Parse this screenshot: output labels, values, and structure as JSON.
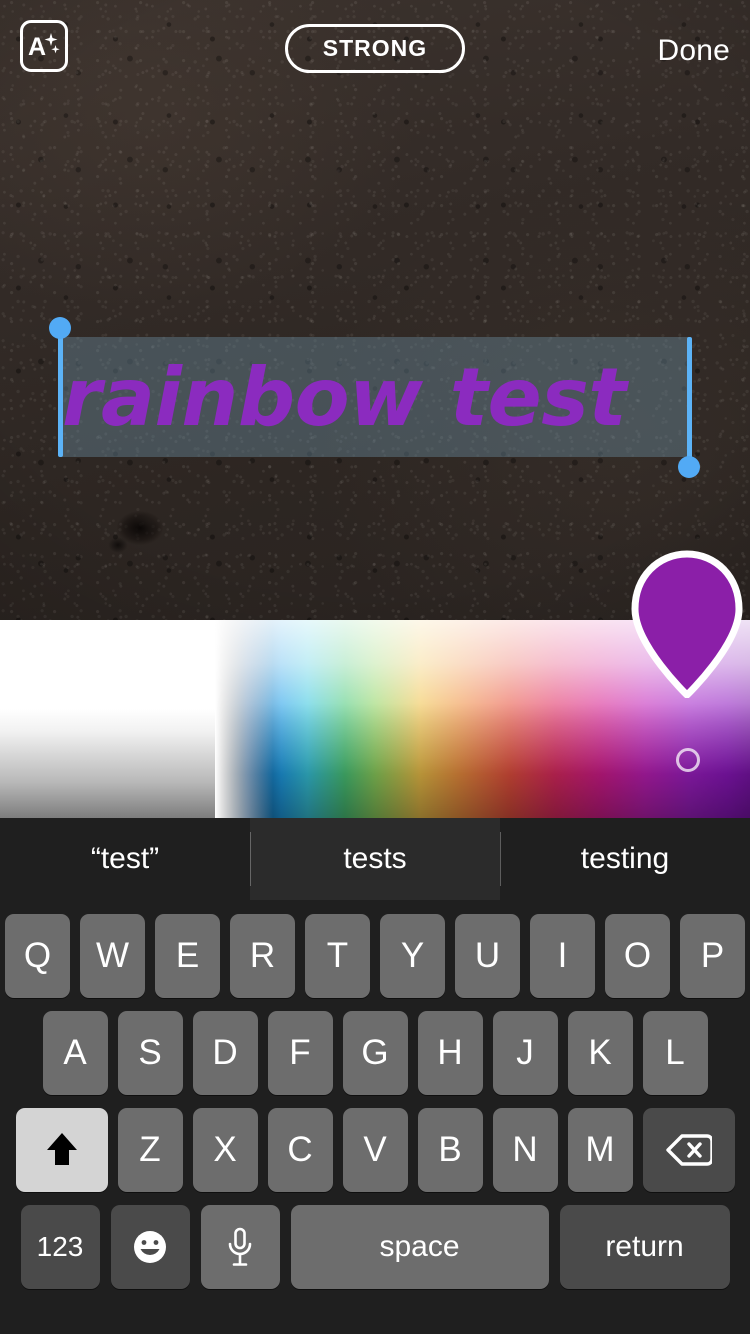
{
  "app": {
    "context": "instagram-story-text-editor",
    "background_description": "dark asphalt pavement photo"
  },
  "top_bar": {
    "style_button": {
      "icon": "text-style-sparkle-icon",
      "letter": "A"
    },
    "font_pill": {
      "label": "STRONG"
    },
    "done_button": {
      "label": "Done"
    }
  },
  "canvas": {
    "text_object": {
      "value": "rainbow test",
      "color": "#8B2BBF",
      "font_style": "bold-italic",
      "selected": true,
      "highlight_color": "rgba(108,140,160,0.42)",
      "handle_color": "#52AAF5"
    }
  },
  "color_picker": {
    "selected_color": "#8B1FA8",
    "marker_icon": "color-pin-marker-icon",
    "previous_swatch_icon": "previous-color-ring-icon",
    "gradient_stops": [
      "#FFFFFF",
      "#E8E8E8",
      "#000000",
      "#0A4D8C",
      "#1F9FE8",
      "#37C6DE",
      "#4CC97A",
      "#8FD35F",
      "#F0C24A",
      "#F09340",
      "#E8513F",
      "#E02A62",
      "#D61C8E",
      "#C01FB8",
      "#A11FC8",
      "#8D16BF"
    ]
  },
  "keyboard": {
    "suggestions": [
      {
        "label": "“test”",
        "highlighted": false
      },
      {
        "label": "tests",
        "highlighted": true
      },
      {
        "label": "testing",
        "highlighted": false
      }
    ],
    "row1": [
      "Q",
      "W",
      "E",
      "R",
      "T",
      "Y",
      "U",
      "I",
      "O",
      "P"
    ],
    "row2": [
      "A",
      "S",
      "D",
      "F",
      "G",
      "H",
      "J",
      "K",
      "L"
    ],
    "row3": [
      "Z",
      "X",
      "C",
      "V",
      "B",
      "N",
      "M"
    ],
    "shift_key": {
      "icon": "shift-arrow-icon",
      "active": true
    },
    "delete_key": {
      "icon": "backspace-delete-icon"
    },
    "bottom_row": {
      "numbers_key": "123",
      "emoji_key": {
        "icon": "emoji-smiley-icon"
      },
      "dictation_key": {
        "icon": "microphone-icon"
      },
      "space_key": "space",
      "return_key": "return"
    }
  }
}
